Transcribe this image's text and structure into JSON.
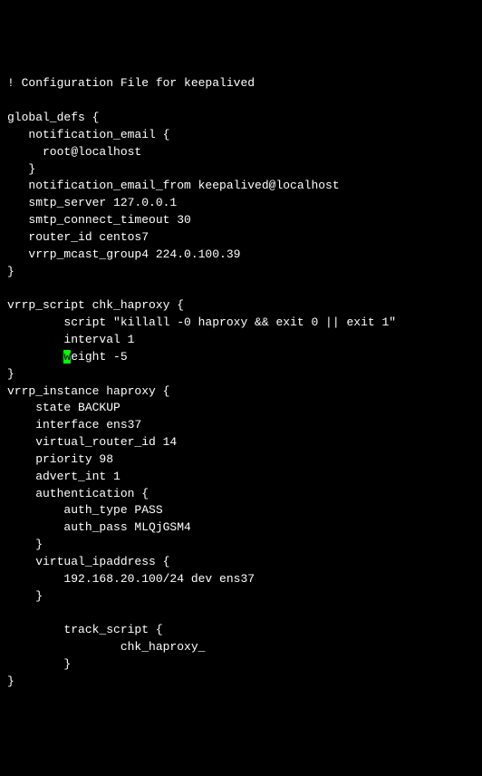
{
  "config": {
    "comment": "! Configuration File for keepalived",
    "global_defs_open": "global_defs {",
    "notification_email_open": "   notification_email {",
    "notification_email_value": "     root@localhost",
    "notification_email_close": "   }",
    "notification_email_from": "   notification_email_from keepalived@localhost",
    "smtp_server": "   smtp_server 127.0.0.1",
    "smtp_connect_timeout": "   smtp_connect_timeout 30",
    "router_id": "   router_id centos7",
    "vrrp_mcast_group4": "   vrrp_mcast_group4 224.0.100.39",
    "global_defs_close": "}",
    "vrrp_script_open": "vrrp_script chk_haproxy {",
    "script_line": "        script \"killall -0 haproxy && exit 0 || exit 1\"",
    "interval_line": "        interval 1",
    "weight_prefix": "        ",
    "weight_cursor_char": "w",
    "weight_rest": "eight -5",
    "vrrp_script_close": "}",
    "vrrp_instance_open": "vrrp_instance haproxy {",
    "state": "    state BACKUP",
    "interface": "    interface ens37",
    "virtual_router_id": "    virtual_router_id 14",
    "priority": "    priority 98",
    "advert_int": "    advert_int 1",
    "authentication_open": "    authentication {",
    "auth_type": "        auth_type PASS",
    "auth_pass": "        auth_pass MLQjGSM4",
    "authentication_close": "    }",
    "virtual_ipaddress_open": "    virtual_ipaddress {",
    "virtual_ipaddress_value": "        192.168.20.100/24 dev ens37",
    "virtual_ipaddress_close": "    }",
    "track_script_open": "        track_script {",
    "track_script_value": "                chk_haproxy_",
    "track_script_close": "        }",
    "vrrp_instance_close": "}"
  }
}
